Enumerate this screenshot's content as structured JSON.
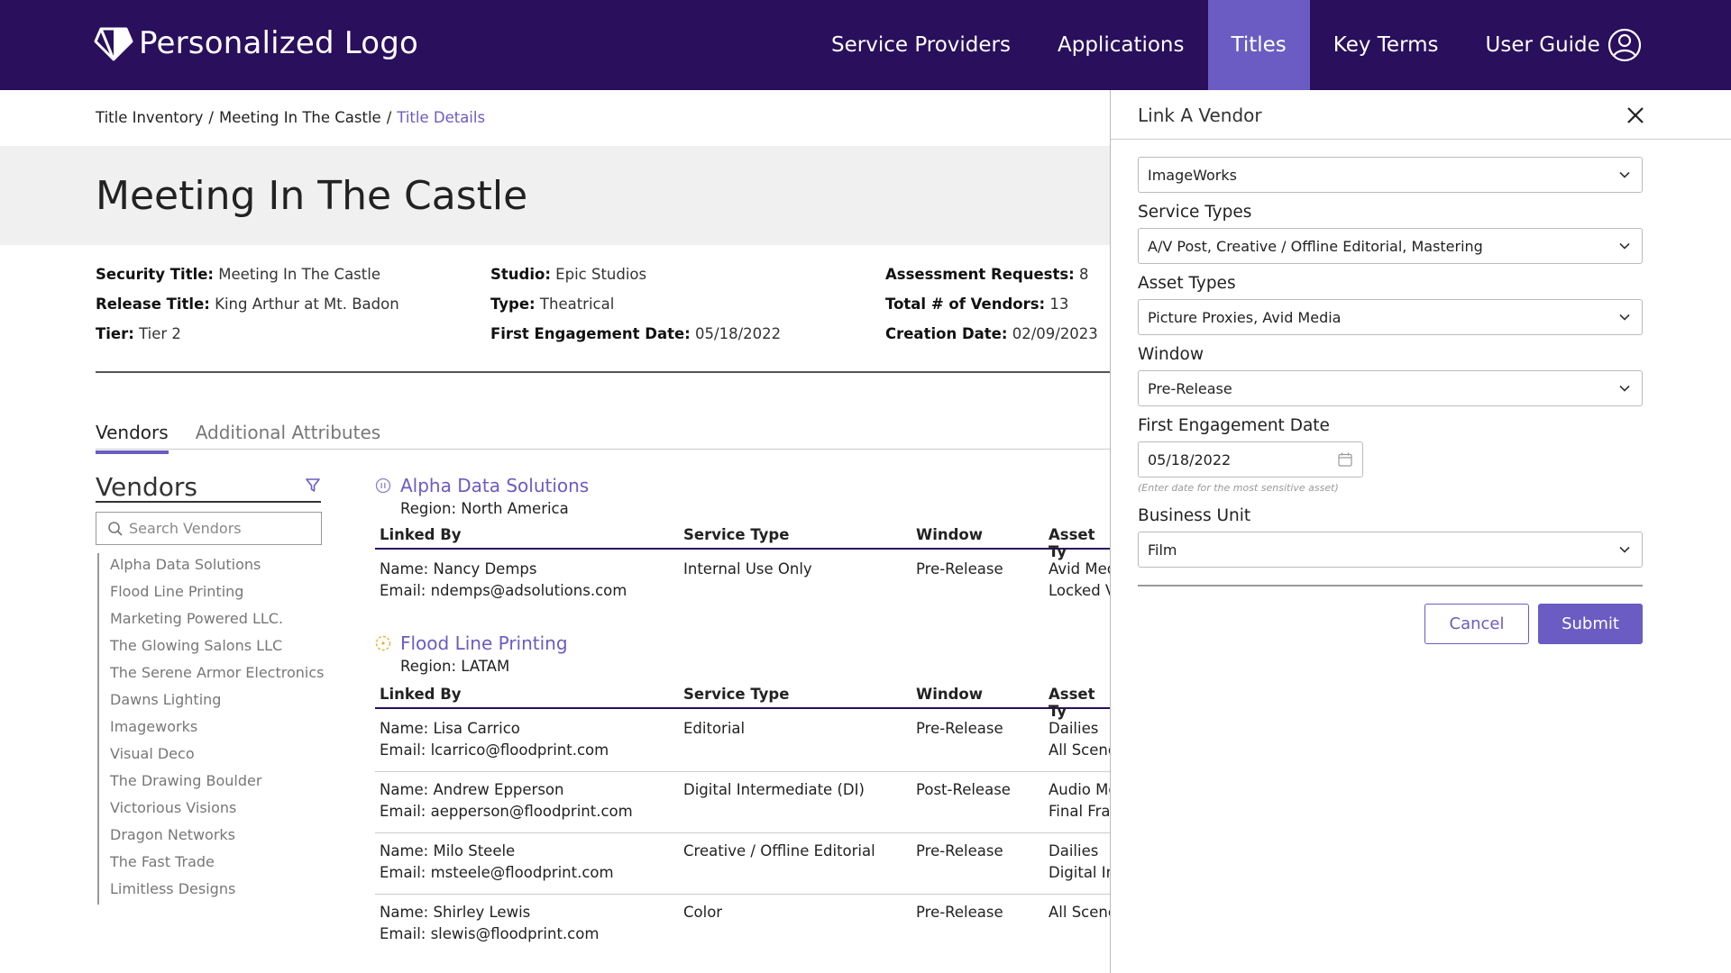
{
  "header": {
    "logo_text": "Personalized Logo",
    "nav": [
      "Service Providers",
      "Applications",
      "Titles",
      "Key Terms",
      "User Guide"
    ],
    "active_nav": "Titles"
  },
  "breadcrumb": {
    "items": [
      "Title Inventory",
      "Meeting In The Castle"
    ],
    "current": "Title Details",
    "separator": "/"
  },
  "page": {
    "title": "Meeting In The Castle"
  },
  "details": {
    "col1": [
      {
        "label": "Security Title:",
        "value": "Meeting In The Castle"
      },
      {
        "label": "Release Title:",
        "value": "King Arthur at Mt. Badon"
      },
      {
        "label": "Tier:",
        "value": "Tier 2"
      }
    ],
    "col2": [
      {
        "label": "Studio:",
        "value": "Epic Studios"
      },
      {
        "label": "Type:",
        "value": "Theatrical"
      },
      {
        "label": "First Engagement Date:",
        "value": "05/18/2022"
      }
    ],
    "col3": [
      {
        "label": "Assessment Requests:",
        "value": "8"
      },
      {
        "label": "Total # of Vendors:",
        "value": "13"
      },
      {
        "label": "Creation Date:",
        "value": "02/09/2023"
      }
    ]
  },
  "tabs": [
    "Vendors",
    "Additional Attributes"
  ],
  "sidebar": {
    "title": "Vendors",
    "search_placeholder": "Search Vendors",
    "vendors": [
      "Alpha Data Solutions",
      "Flood Line Printing",
      "Marketing Powered LLC.",
      "The Glowing Salons LLC",
      "The Serene Armor Electronics",
      "Dawns Lighting",
      "Imageworks",
      "Visual Deco",
      "The Drawing Boulder",
      "Victorious Visions",
      "Dragon Networks",
      "The Fast Trade",
      "Limitless Designs"
    ]
  },
  "table_headers": [
    "Linked By",
    "Service Type",
    "Window",
    "Asset Ty"
  ],
  "vendor_groups": [
    {
      "name": "Alpha Data Solutions",
      "region": "Region: North America",
      "rows": [
        {
          "name": "Name: Nancy Demps",
          "email": "Email: ndemps@adsolutions.com",
          "service": "Internal Use Only",
          "window": "Pre-Release",
          "asset1": "Avid Med",
          "asset2": "Locked V"
        }
      ]
    },
    {
      "name": "Flood Line Printing",
      "region": "Region: LATAM",
      "rows": [
        {
          "name": "Name: Lisa Carrico",
          "email": "Email: lcarrico@floodprint.com",
          "service": "Editorial",
          "window": "Pre-Release",
          "asset1": "Dailies",
          "asset2": "All Scene"
        },
        {
          "name": "Name: Andrew Epperson",
          "email": "Email: aepperson@floodprint.com",
          "service": "Digital Intermediate (DI)",
          "window": "Post-Release",
          "asset1": "Audio Mo",
          "asset2": "Final Fra"
        },
        {
          "name": "Name: Milo Steele",
          "email": "Email: msteele@floodprint.com",
          "service": "Creative / Offline Editorial",
          "window": "Pre-Release",
          "asset1": "Dailies",
          "asset2": "Digital In"
        },
        {
          "name": "Name: Shirley Lewis",
          "email": "Email: slewis@floodprint.com",
          "service": "Color",
          "window": "Pre-Release",
          "asset1": "All Scene",
          "asset2": ""
        }
      ]
    }
  ],
  "panel": {
    "title": "Link A Vendor",
    "vendor_value": "ImageWorks",
    "service_types_label": "Service Types",
    "service_types_value": "A/V Post, Creative / Offline Editorial, Mastering",
    "asset_types_label": "Asset Types",
    "asset_types_value": "Picture Proxies, Avid Media",
    "window_label": "Window",
    "window_value": "Pre-Release",
    "first_engagement_label": "First Engagement Date",
    "first_engagement_value": "05/18/2022",
    "first_engagement_hint": "(Enter date for the most sensitive asset)",
    "business_unit_label": "Business Unit",
    "business_unit_value": "Film",
    "cancel_label": "Cancel",
    "submit_label": "Submit"
  },
  "colors": {
    "header_bg": "#2a0f5c",
    "accent": "#6a5cc2"
  }
}
